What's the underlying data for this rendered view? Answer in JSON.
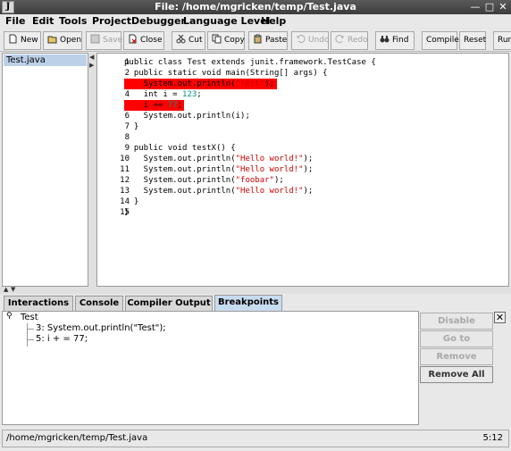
{
  "window": {
    "title": "File: /home/mgricken/temp/Test.java",
    "app_icon": "J"
  },
  "menu": [
    "File",
    "Edit",
    "Tools",
    "Project",
    "Debugger",
    "Language Level",
    "Help"
  ],
  "toolbar": {
    "new": "New",
    "open": "Open",
    "save": "Save",
    "close": "Close",
    "cut": "Cut",
    "copy": "Copy",
    "paste": "Paste",
    "undo": "Undo",
    "redo": "Redo",
    "find": "Find",
    "compile": "Compile",
    "reset": "Reset",
    "run": "Run"
  },
  "files": [
    "Test.java"
  ],
  "editor": {
    "breakpoint_color": "#ff0000",
    "lines": [
      {
        "n": "1",
        "text": "public class Test extends junit.framework.TestCase {"
      },
      {
        "n": "2",
        "text": "  public static void main(String[] args) {"
      },
      {
        "n": "3",
        "pre": "    System.out.println(",
        "str": "\"Test\"",
        "post": ");",
        "breakpoint": true
      },
      {
        "n": "4",
        "pre": "    int i = ",
        "num": "123",
        "post": ";"
      },
      {
        "n": "5",
        "pre": "    i += ",
        "num": "77",
        "post": ";",
        "breakpoint": true
      },
      {
        "n": "6",
        "text": "    System.out.println(i);"
      },
      {
        "n": "7",
        "text": "  }"
      },
      {
        "n": "8",
        "text": ""
      },
      {
        "n": "9",
        "text": "  public void testX() {"
      },
      {
        "n": "10",
        "pre": "    System.out.println(",
        "str": "\"Hello world!\"",
        "post": ");"
      },
      {
        "n": "11",
        "pre": "    System.out.println(",
        "str": "\"Hello world!\"",
        "post": ");"
      },
      {
        "n": "12",
        "pre": "    System.out.println(",
        "str": "\"foobar\"",
        "post": ");"
      },
      {
        "n": "13",
        "pre": "    System.out.println(",
        "str": "\"Hello world!\"",
        "post": ");"
      },
      {
        "n": "14",
        "text": "  }"
      },
      {
        "n": "15",
        "text": "}"
      }
    ]
  },
  "tabs": [
    "Interactions",
    "Console",
    "Compiler Output",
    "Breakpoints"
  ],
  "active_tab": "Breakpoints",
  "breakpoints": {
    "root": "Test",
    "items": [
      "3: System.out.println(\"Test\");",
      "5: i + = 77;"
    ]
  },
  "buttons": {
    "disable": "Disable",
    "goto": "Go to",
    "remove": "Remove",
    "remove_all": "Remove All"
  },
  "status": {
    "path": "/home/mgricken/temp/Test.java",
    "position": "5:12"
  }
}
